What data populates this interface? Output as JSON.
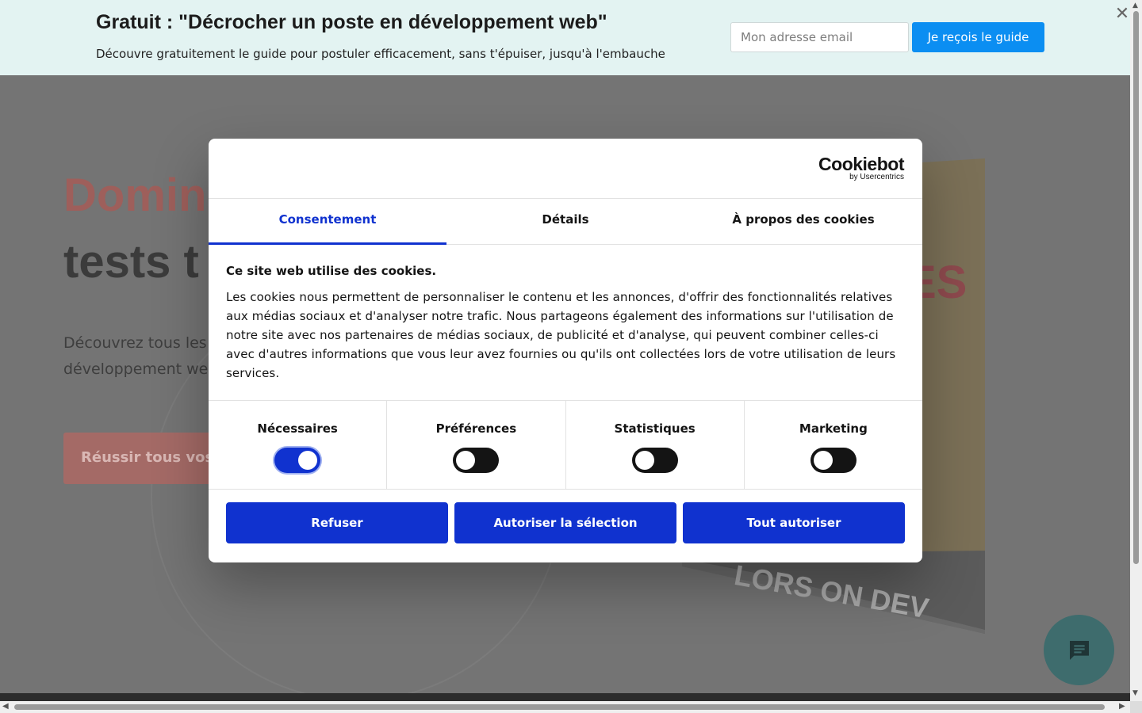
{
  "promo": {
    "title": "Gratuit : \"Décrocher un poste en développement web\"",
    "subtitle": "Découvre gratuitement le guide pour postuler efficacement, sans t'épuiser, jusqu'à l'embauche",
    "email_placeholder": "Mon adresse email",
    "button_label": "Je reçois le guide",
    "close_glyph": "✕"
  },
  "hero": {
    "title_line_1": "Domin",
    "title_line_2": "tests t",
    "desc_line_1": "Découvrez tous les",
    "desc_line_2": "développement web",
    "cta_label": "Réussir tous vos",
    "book_spine_text": "ES",
    "book_bottom_text": "LORS ON DEV"
  },
  "cookie": {
    "logo_main": "Cookiebot",
    "logo_sub": "by Usercentrics",
    "tabs": [
      {
        "label": "Consentement",
        "active": true
      },
      {
        "label": "Détails",
        "active": false
      },
      {
        "label": "À propos des cookies",
        "active": false
      }
    ],
    "body_title": "Ce site web utilise des cookies.",
    "body_text": "Les cookies nous permettent de personnaliser le contenu et les annonces, d'offrir des fonctionnalités relatives aux médias sociaux et d'analyser notre trafic. Nous partageons également des informations sur l'utilisation de notre site avec nos partenaires de médias sociaux, de publicité et d'analyse, qui peuvent combiner celles-ci avec d'autres informations que vous leur avez fournies ou qu'ils ont collectées lors de votre utilisation de leurs services.",
    "categories": [
      {
        "label": "Nécessaires",
        "enabled": true
      },
      {
        "label": "Préférences",
        "enabled": false
      },
      {
        "label": "Statistiques",
        "enabled": false
      },
      {
        "label": "Marketing",
        "enabled": false
      }
    ],
    "buttons": {
      "refuse": "Refuser",
      "allow_selection": "Autoriser la sélection",
      "allow_all": "Tout autoriser"
    }
  },
  "colors": {
    "brand_blue": "#1032cf",
    "promo_bg": "#e3f3f2",
    "promo_button": "#0b8ef2",
    "overlay_bg": "#747474"
  },
  "icons": {
    "chat": "chat-bubble-icon",
    "close": "close-icon"
  }
}
